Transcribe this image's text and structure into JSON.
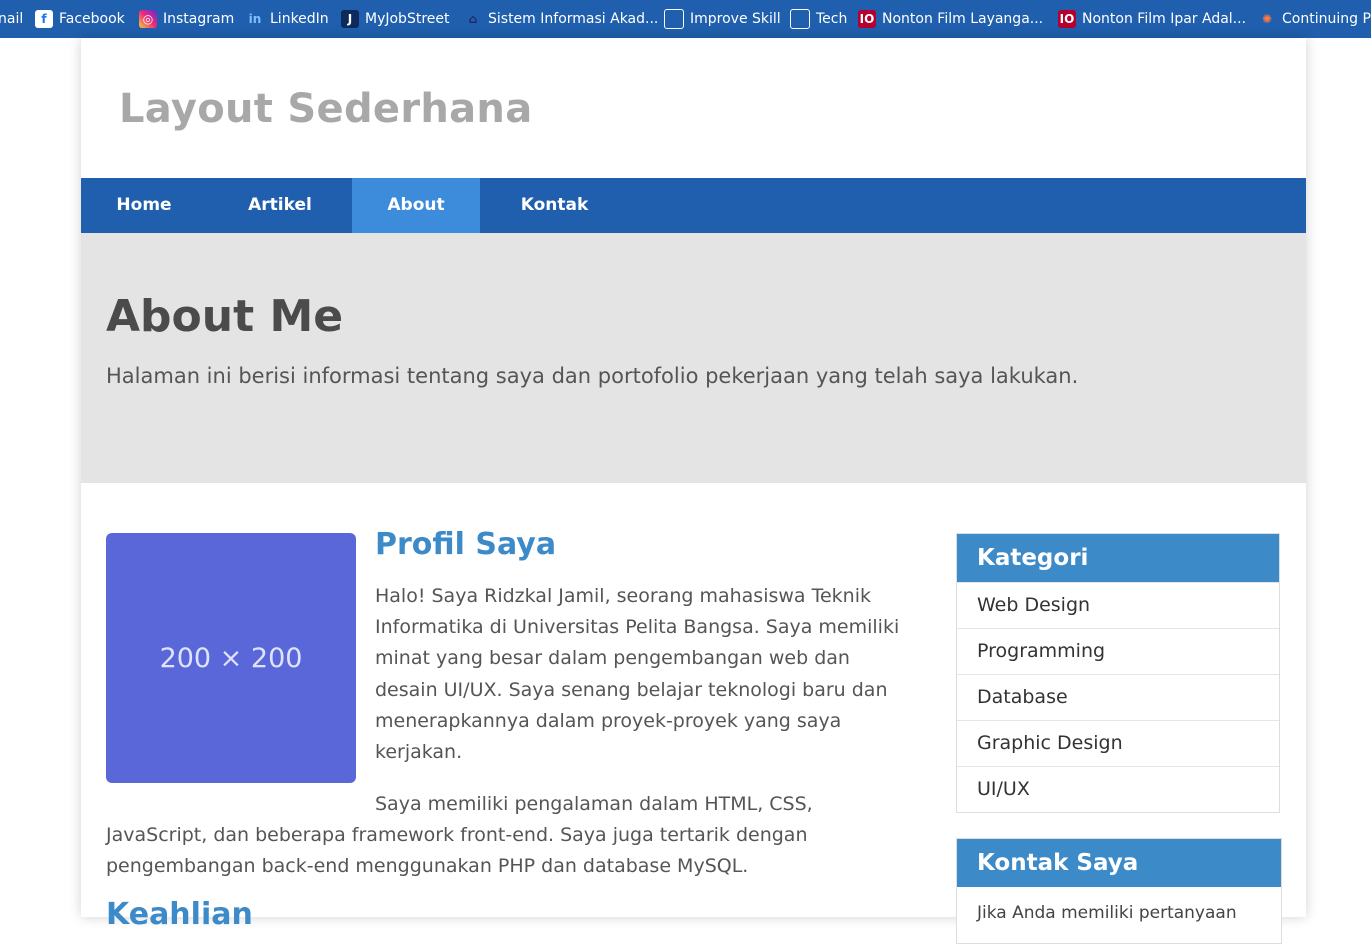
{
  "bookmarks": [
    {
      "label": "nail",
      "icon": "mail-icon"
    },
    {
      "label": "Facebook",
      "icon": "facebook-icon"
    },
    {
      "label": "Instagram",
      "icon": "instagram-icon"
    },
    {
      "label": "LinkedIn",
      "icon": "linkedin-icon"
    },
    {
      "label": "MyJobStreet",
      "icon": "jobstreet-icon"
    },
    {
      "label": "Sistem Informasi Akad...",
      "icon": "university-icon"
    },
    {
      "label": "Improve Skill",
      "icon": "folder-icon"
    },
    {
      "label": "Tech",
      "icon": "folder-icon"
    },
    {
      "label": "Nonton Film Layanga...",
      "icon": "film-icon"
    },
    {
      "label": "Nonton Film Ipar Adal...",
      "icon": "film-icon"
    },
    {
      "label": "Continuing Pr",
      "icon": "sparkle-icon"
    }
  ],
  "site": {
    "title": "Layout Sederhana"
  },
  "nav": {
    "items": [
      "Home",
      "Artikel",
      "About",
      "Kontak"
    ],
    "active": "About"
  },
  "hero": {
    "title": "About Me",
    "subtitle": "Halaman ini berisi informasi tentang saya dan portofolio pekerjaan yang telah saya lakukan."
  },
  "profile": {
    "image_placeholder": "200 × 200",
    "title": "Profil Saya",
    "paragraph1": "Halo! Saya Ridzkal Jamil, seorang mahasiswa Teknik Informatika di Universitas Pelita Bangsa. Saya memiliki minat yang besar dalam pengembangan web dan desain UI/UX. Saya senang belajar teknologi baru dan menerapkannya dalam proyek-proyek yang saya kerjakan.",
    "paragraph2": "Saya memiliki pengalaman dalam HTML, CSS, JavaScript, dan beberapa framework front-end. Saya juga tertarik dengan pengembangan back-end menggunakan PHP dan database MySQL.",
    "next_heading": "Keahlian"
  },
  "sidebar": {
    "kategori": {
      "title": "Kategori",
      "items": [
        "Web Design",
        "Programming",
        "Database",
        "Graphic Design",
        "UI/UX"
      ]
    },
    "kontak": {
      "title": "Kontak Saya",
      "body": "Jika Anda memiliki pertanyaan"
    }
  },
  "colors": {
    "nav": "#1f5fad",
    "nav_active": "#3d8bdb",
    "accent": "#3d8ac9",
    "hero_bg": "#e4e4e4",
    "placeholder": "#5a67d8"
  }
}
